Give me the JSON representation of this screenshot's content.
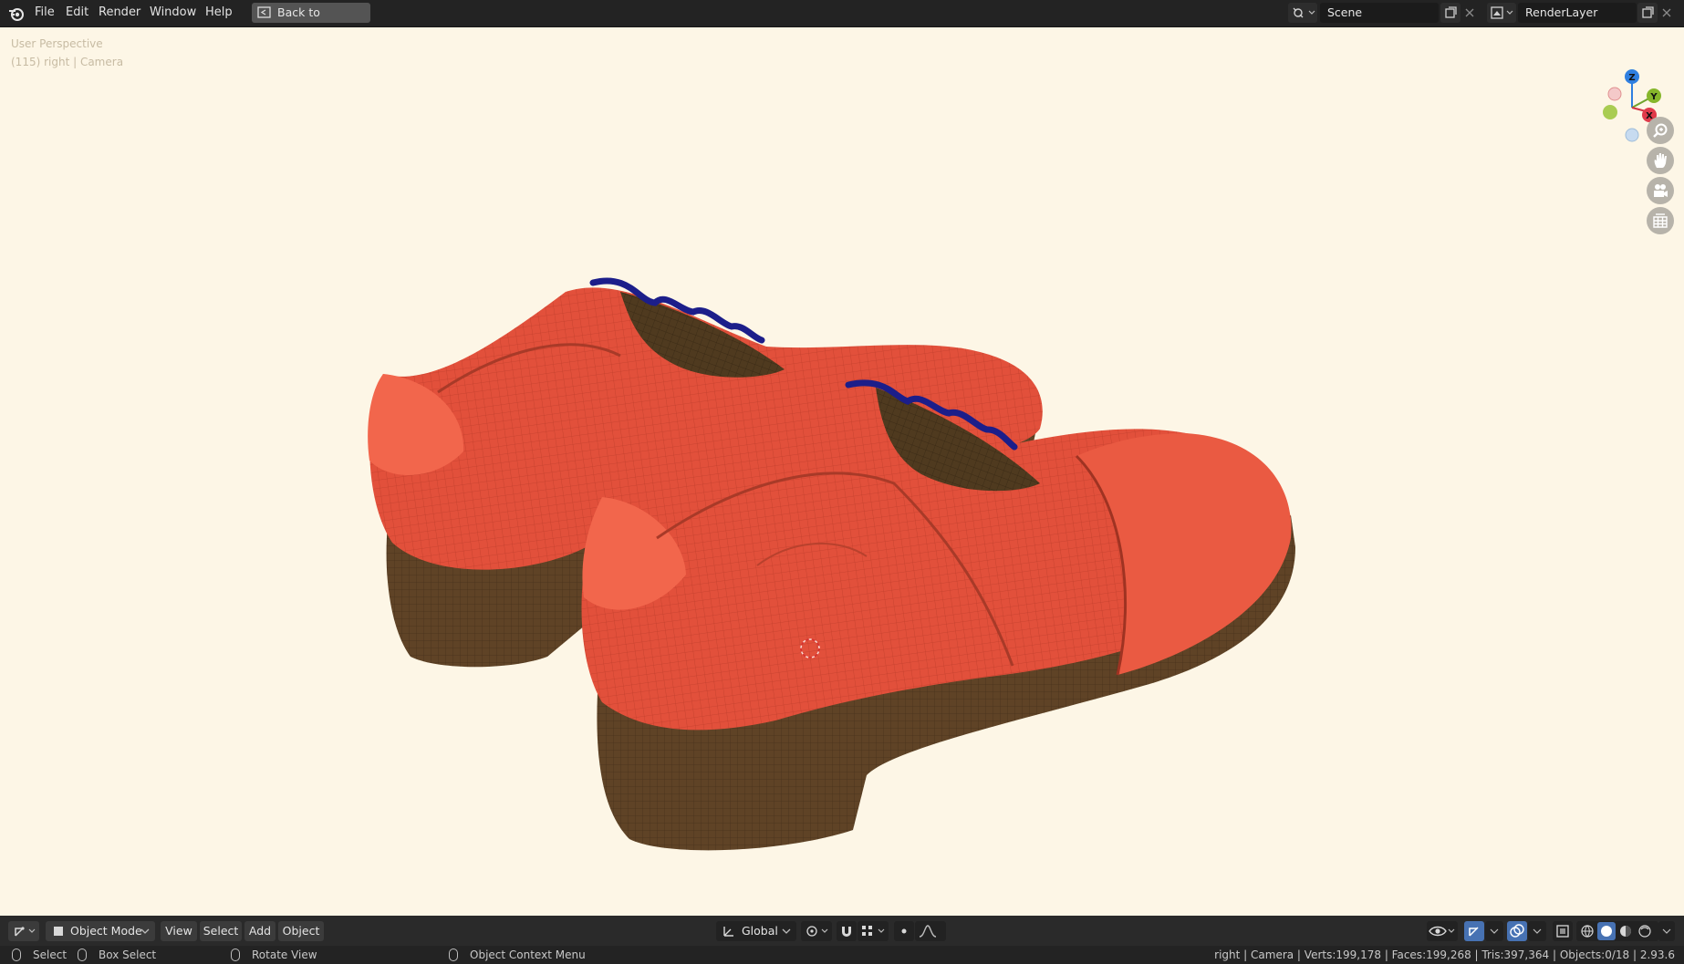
{
  "menu": [
    "File",
    "Edit",
    "Render",
    "Window",
    "Help"
  ],
  "back_button": "Back to Previous",
  "scene_field": "Scene",
  "renderlayer_field": "RenderLayer",
  "viewport": {
    "line1": "User Perspective",
    "line2": "(115) right | Camera"
  },
  "gizmo": {
    "z": "Z",
    "y": "Y",
    "x": "X"
  },
  "header": {
    "mode": "Object Mode",
    "view": "View",
    "select": "Select",
    "add": "Add",
    "object": "Object",
    "orientation": "Global"
  },
  "status": {
    "select": "Select",
    "box_select": "Box Select",
    "rotate_view": "Rotate View",
    "context_menu": "Object Context Menu",
    "stats": "right | Camera | Verts:199,178 | Faces:199,268 | Tris:397,364 | Objects:0/18 | 2.93.6"
  },
  "colors": {
    "viewport_bg": "#fdf6e6",
    "shoe_leather": "#e2503b",
    "sole": "#5f4326",
    "laces": "#1c1e8a",
    "tongue": "#4f3a1f"
  }
}
